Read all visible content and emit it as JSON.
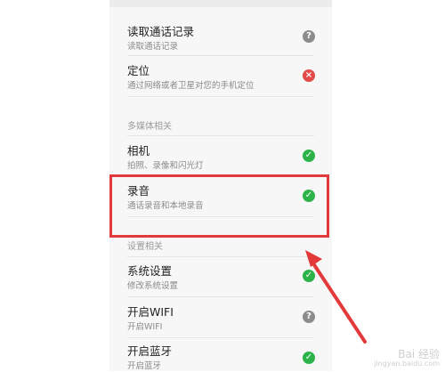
{
  "permissions": [
    {
      "title": "读取通话记录",
      "desc": "读取通话记录",
      "status": "unknown"
    },
    {
      "title": "定位",
      "desc": "通过网络或者卫星对您的手机定位",
      "status": "deny"
    }
  ],
  "sections": {
    "multimedia": "多媒体相关",
    "settings": "设置相关"
  },
  "media": [
    {
      "title": "相机",
      "desc": "拍照、录像和闪光灯",
      "status": "allow"
    },
    {
      "title": "录音",
      "desc": "通话录音和本地录音",
      "status": "allow"
    }
  ],
  "settings_items": [
    {
      "title": "系统设置",
      "desc": "修改系统设置",
      "status": "allow"
    },
    {
      "title": "开启WIFI",
      "desc": "开启WIFI",
      "status": "unknown"
    },
    {
      "title": "开启蓝牙",
      "desc": "开启蓝牙",
      "status": "allow"
    }
  ],
  "icons": {
    "allow": "check-icon",
    "unknown": "question-icon",
    "deny": "close-icon"
  },
  "colors": {
    "allow": "#2cb44a",
    "unknown": "#8c8c8c",
    "deny": "#e34b4b",
    "highlight": "#e23a3a"
  },
  "watermark": {
    "main": "Bai 经验",
    "sub": "jingyan.baidu.com"
  }
}
